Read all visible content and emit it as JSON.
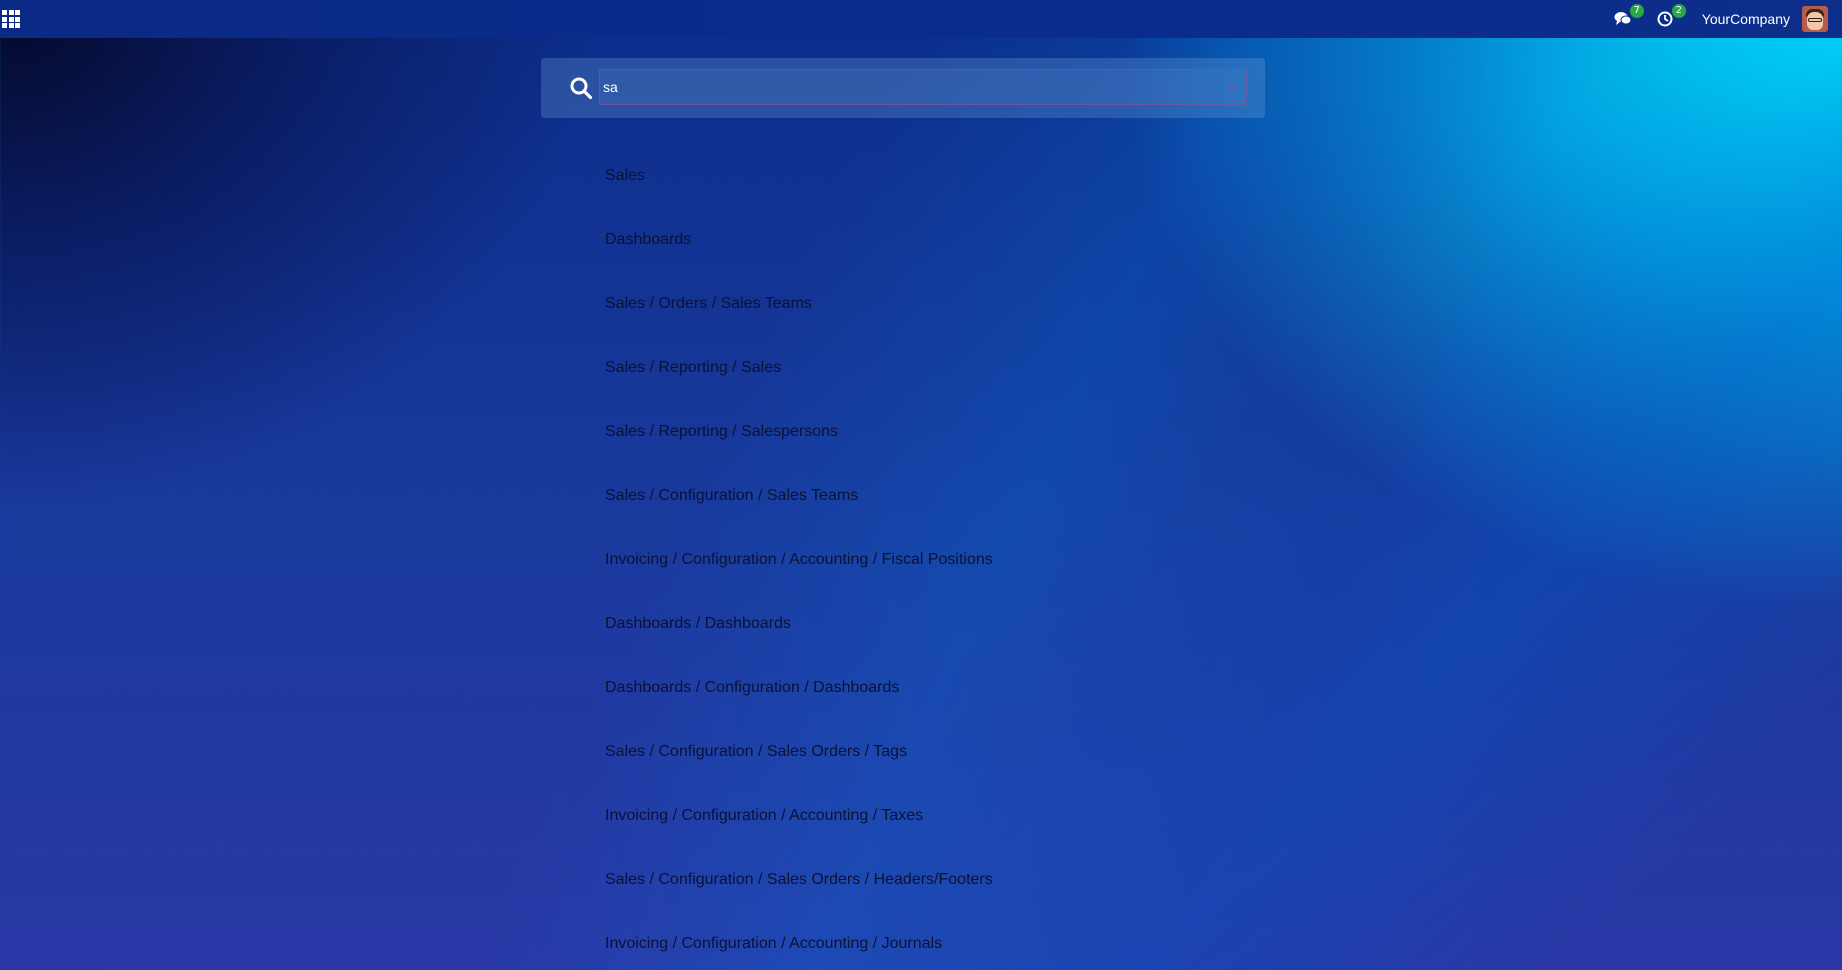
{
  "topbar": {
    "apps_icon": "apps-grid-icon",
    "messages": {
      "icon": "chat-icon",
      "count": "7"
    },
    "activities": {
      "icon": "clock-icon",
      "count": "2"
    },
    "company": "YourCompany",
    "avatar_icon": "user-avatar"
  },
  "search": {
    "value": "sa",
    "placeholder": "",
    "icon": "search-icon",
    "clear_icon": "close-icon"
  },
  "results": [
    "Sales",
    "Dashboards",
    "Sales / Orders / Sales Teams",
    "Sales / Reporting / Sales",
    "Sales / Reporting / Salespersons",
    "Sales / Configuration / Sales Teams",
    "Invoicing / Configuration / Accounting / Fiscal Positions",
    "Dashboards / Dashboards",
    "Dashboards / Configuration / Dashboards",
    "Sales / Configuration / Sales Orders / Tags",
    "Invoicing / Configuration / Accounting / Taxes",
    "Sales / Configuration / Sales Orders / Headers/Footers",
    "Invoicing / Configuration / Accounting / Journals"
  ],
  "colors": {
    "topbar": "#0b2a86",
    "badge": "#28a745",
    "result_text": "#0d1133"
  }
}
